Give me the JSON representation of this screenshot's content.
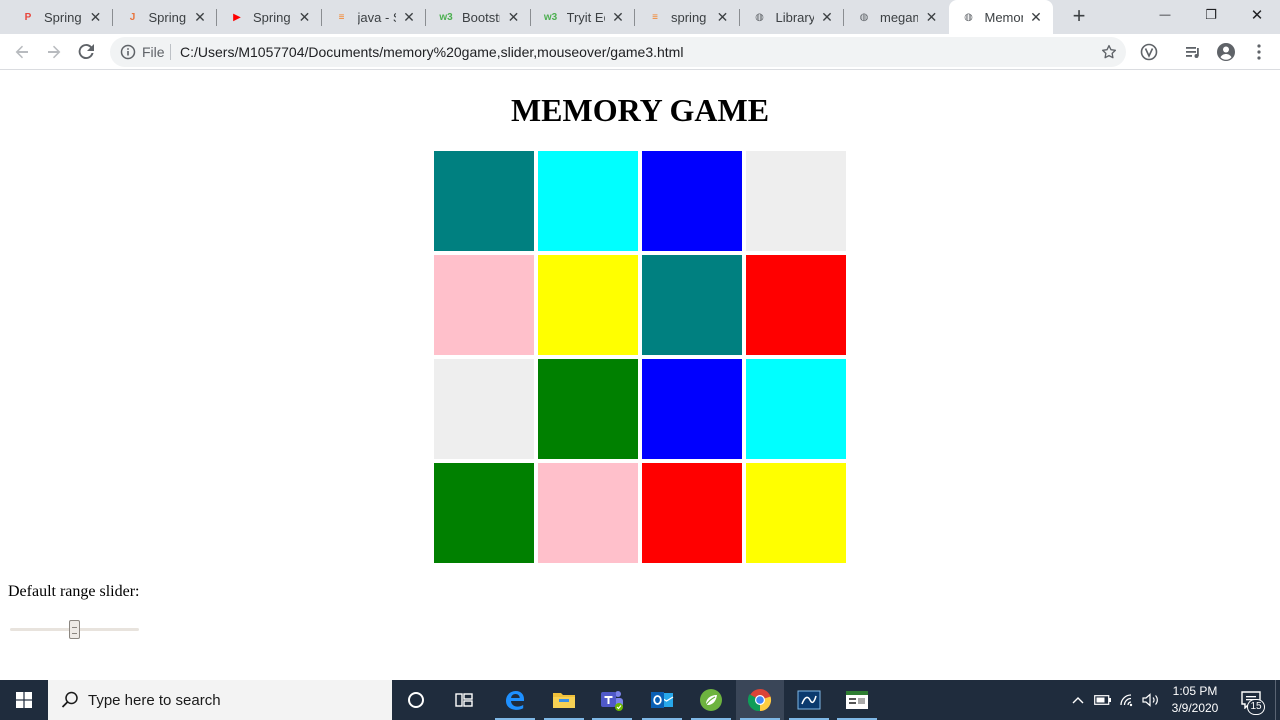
{
  "browser": {
    "tabs": [
      {
        "title": "Spring Boot",
        "favicon": "spring-pdf-icon",
        "color": "#e8453c",
        "glyph": "P"
      },
      {
        "title": "Spring B",
        "favicon": "javatpoint-icon",
        "color": "#e8743c",
        "glyph": "J"
      },
      {
        "title": "Spring B",
        "favicon": "youtube-icon",
        "color": "#ff0000",
        "glyph": "▶"
      },
      {
        "title": "java - Sp",
        "favicon": "stackoverflow-icon",
        "color": "#f48024",
        "glyph": "≡"
      },
      {
        "title": "Bootstrap",
        "favicon": "w3schools-icon",
        "color": "#4caf50",
        "glyph": "w3"
      },
      {
        "title": "Tryit Edi",
        "favicon": "w3schools-icon",
        "color": "#4caf50",
        "glyph": "w3"
      },
      {
        "title": "spring",
        "favicon": "stackoverflow-icon",
        "color": "#f48024",
        "glyph": "≡"
      },
      {
        "title": "Library",
        "favicon": "globe-icon",
        "color": "#5f6368",
        "glyph": "◍"
      },
      {
        "title": "megam",
        "favicon": "globe-icon",
        "color": "#5f6368",
        "glyph": "◍"
      },
      {
        "title": "Memory",
        "favicon": "globe-icon",
        "color": "#5f6368",
        "glyph": "◍",
        "active": true
      }
    ],
    "new_tab_label": "+",
    "close_glyph": "✕",
    "window_controls": {
      "minimize": "—",
      "restore": "❐",
      "close": "✕"
    },
    "address": {
      "scheme_label": "File",
      "url": "C:/Users/M1057704/Documents/memory%20game,slider,mouseover/game3.html"
    }
  },
  "page": {
    "title": "MEMORY GAME",
    "cards": [
      {
        "color": "#008080"
      },
      {
        "color": "#00ffff"
      },
      {
        "color": "#0000ff"
      },
      {
        "color": "#eeeeee"
      },
      {
        "color": "#ffc0cb"
      },
      {
        "color": "#ffff00"
      },
      {
        "color": "#008080"
      },
      {
        "color": "#ff0000"
      },
      {
        "color": "#eeeeee"
      },
      {
        "color": "#008000"
      },
      {
        "color": "#0000ff"
      },
      {
        "color": "#00ffff"
      },
      {
        "color": "#008000"
      },
      {
        "color": "#ffc0cb"
      },
      {
        "color": "#ff0000"
      },
      {
        "color": "#ffff00"
      }
    ],
    "slider": {
      "label": "Default range slider:",
      "min": 0,
      "max": 100,
      "value": 50
    }
  },
  "taskbar": {
    "search_placeholder": "Type here to search",
    "clock_time": "1:05 PM",
    "clock_date": "3/9/2020",
    "notification_count": "15"
  }
}
